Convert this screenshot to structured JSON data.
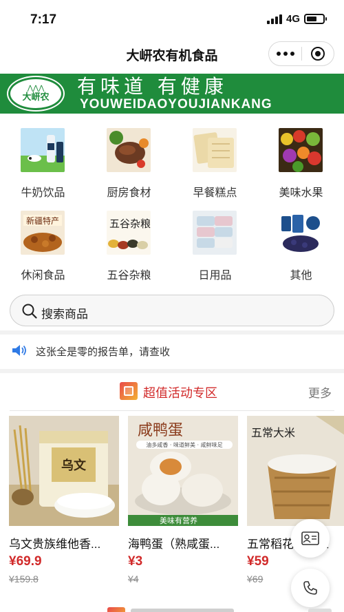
{
  "status_bar": {
    "time": "7:17",
    "network": "4G",
    "battery_level": 0.65
  },
  "nav": {
    "title": "大岍农有机食品"
  },
  "banner": {
    "logo_text": "大岍农",
    "slogan": "有味道 有健康",
    "pinyin": "YOUWEIDAOYOUJIANKANG"
  },
  "categories": [
    {
      "label": "牛奶饮品",
      "icon": "milk-drink-icon"
    },
    {
      "label": "厨房食材",
      "icon": "kitchen-ingredients-icon"
    },
    {
      "label": "早餐糕点",
      "icon": "breakfast-pastry-icon"
    },
    {
      "label": "美味水果",
      "icon": "fruit-icon"
    },
    {
      "label": "休闲食品",
      "icon": "snack-icon"
    },
    {
      "label": "五谷杂粮",
      "icon": "grains-icon"
    },
    {
      "label": "日用品",
      "icon": "daily-goods-icon"
    },
    {
      "label": "其他",
      "icon": "other-icon"
    }
  ],
  "search": {
    "placeholder": "搜索商品"
  },
  "notice": {
    "text": "这张全是零的报告单，请查收"
  },
  "promo_section": {
    "title": "超值活动专区",
    "more": "更多",
    "products": [
      {
        "name": "乌文贵族维他香...",
        "price": "¥69.9",
        "original_price": "¥159.8",
        "image_text": "乌文"
      },
      {
        "name": "海鸭蛋（熟咸蛋...",
        "price": "¥3",
        "original_price": "¥4",
        "image_text": "咸鸭蛋",
        "image_tagline": "油多咸香 · 味道鲜美 · 咸鲜味足",
        "image_caption": "美味有营养"
      },
      {
        "name": "五常稻花香大米",
        "price": "¥59",
        "original_price": "¥69",
        "image_text": "五常大米"
      }
    ]
  },
  "colors": {
    "brand_green": "#1f8c3c",
    "price_red": "#d12a2a",
    "section_red": "#d12a2a"
  }
}
